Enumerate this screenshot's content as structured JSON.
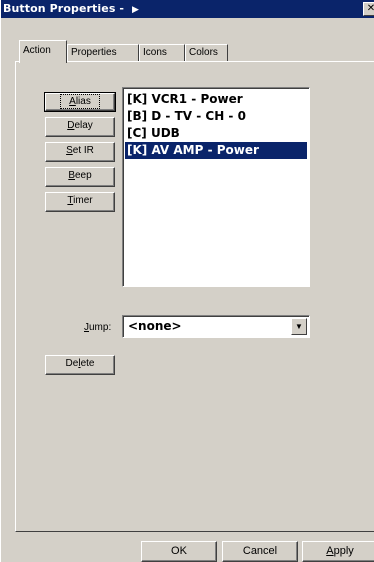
{
  "window": {
    "title": "Button Properties - ",
    "title_arrow": "▶",
    "close_glyph": "✕"
  },
  "tabs": [
    {
      "label": "Action",
      "active": true
    },
    {
      "label": "Properties",
      "active": false
    },
    {
      "label": "Icons",
      "active": false
    },
    {
      "label": "Colors",
      "active": false
    }
  ],
  "side_buttons": {
    "alias": {
      "underline": "A",
      "rest": "lias"
    },
    "delay": {
      "underline": "D",
      "rest": "elay"
    },
    "set_ir": {
      "underline": "S",
      "rest": "et IR"
    },
    "beep": {
      "underline": "B",
      "rest": "eep"
    },
    "timer": {
      "underline": "T",
      "rest": "imer"
    }
  },
  "action_list": {
    "items": [
      "[K] VCR1 - Power",
      "[B] D - TV - CH - 0",
      "[C] UDB",
      "[K] AV  AMP - Power"
    ],
    "selected_index": 3
  },
  "jump": {
    "label_underline": "J",
    "label_rest": "ump:",
    "value": "<none>",
    "arrow": "▼"
  },
  "delete_button": {
    "pre": "De",
    "underline": "l",
    "post": "ete"
  },
  "footer": {
    "ok": "OK",
    "cancel": "Cancel",
    "apply_underline": "A",
    "apply_rest": "pply"
  },
  "colors": {
    "face": "#d4d0c8",
    "titlebar": "#0a246a",
    "selection": "#0a246a"
  }
}
